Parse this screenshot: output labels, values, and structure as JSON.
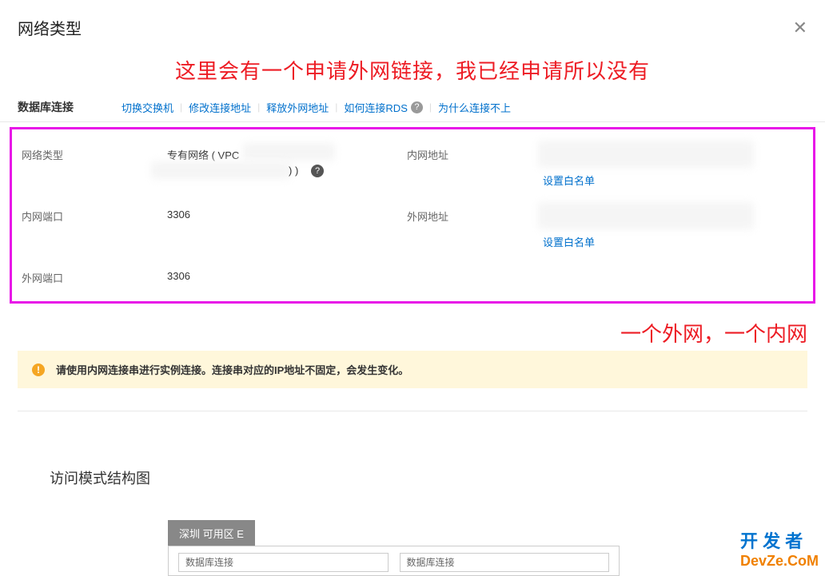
{
  "modal": {
    "title": "网络类型",
    "close": "✕"
  },
  "annotations": {
    "top": "这里会有一个申请外网链接，我已经申请所以没有",
    "right": "一个外网，一个内网"
  },
  "section": {
    "title": "数据库连接",
    "actions": {
      "switch_switch": "切换交换机",
      "modify_addr": "修改连接地址",
      "release_public": "释放外网地址",
      "how_connect": "如何连接RDS",
      "why_fail": "为什么连接不上"
    }
  },
  "info": {
    "network_type_label": "网络类型",
    "network_type_value": "专有网络 ( VPC",
    "internal_port_label": "内网端口",
    "internal_port_value": "3306",
    "external_port_label": "外网端口",
    "external_port_value": "3306",
    "internal_addr_label": "内网地址",
    "external_addr_label": "外网地址",
    "whitelist_link": "设置白名单",
    "masked_suffix": ") )"
  },
  "notice": {
    "text": "请使用内网连接串进行实例连接。连接串对应的IP地址不固定，会发生变化。"
  },
  "diagram": {
    "title": "访问模式结构图",
    "zone": "深圳 可用区 E",
    "box_label": "数据库连接"
  },
  "watermark": {
    "line1": "开 发 者",
    "line2": "DevZe.CoM"
  }
}
